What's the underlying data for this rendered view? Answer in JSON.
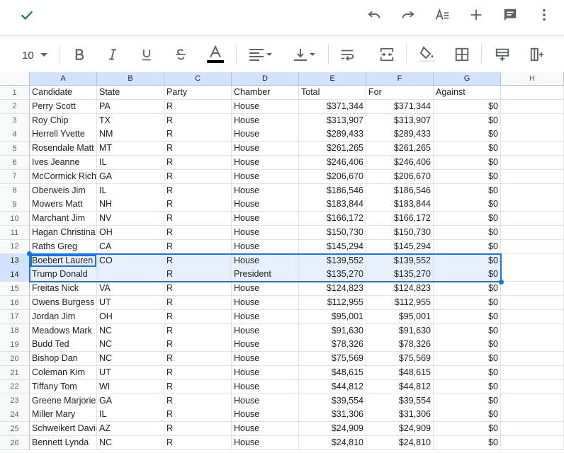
{
  "toolbar": {
    "font_size": "10"
  },
  "columns": [
    "A",
    "B",
    "C",
    "D",
    "E",
    "F",
    "G",
    "H"
  ],
  "rows": [
    {
      "n": "1",
      "c": [
        "Candidate",
        "State",
        "Party",
        "Chamber",
        "Total",
        "For",
        "Against"
      ]
    },
    {
      "n": "2",
      "c": [
        "Perry Scott",
        "PA",
        "R",
        "House",
        "$371,344",
        "$371,344",
        "$0"
      ]
    },
    {
      "n": "3",
      "c": [
        "Roy Chip",
        "TX",
        "R",
        "House",
        "$313,907",
        "$313,907",
        "$0"
      ]
    },
    {
      "n": "4",
      "c": [
        "Herrell Yvette",
        "NM",
        "R",
        "House",
        "$289,433",
        "$289,433",
        "$0"
      ]
    },
    {
      "n": "5",
      "c": [
        "Rosendale Matt",
        "MT",
        "R",
        "House",
        "$261,265",
        "$261,265",
        "$0"
      ]
    },
    {
      "n": "6",
      "c": [
        "Ives Jeanne",
        "IL",
        "R",
        "House",
        "$246,406",
        "$246,406",
        "$0"
      ]
    },
    {
      "n": "7",
      "c": [
        "McCormick Rich",
        "GA",
        "R",
        "House",
        "$206,670",
        "$206,670",
        "$0"
      ]
    },
    {
      "n": "8",
      "c": [
        "Oberweis Jim",
        "IL",
        "R",
        "House",
        "$186,546",
        "$186,546",
        "$0"
      ]
    },
    {
      "n": "9",
      "c": [
        "Mowers Matt",
        "NH",
        "R",
        "House",
        "$183,844",
        "$183,844",
        "$0"
      ]
    },
    {
      "n": "10",
      "c": [
        "Marchant Jim",
        "NV",
        "R",
        "House",
        "$166,172",
        "$166,172",
        "$0"
      ]
    },
    {
      "n": "11",
      "c": [
        "Hagan Christina",
        "OH",
        "R",
        "House",
        "$150,730",
        "$150,730",
        "$0"
      ]
    },
    {
      "n": "12",
      "c": [
        "Raths Greg",
        "CA",
        "R",
        "House",
        "$145,294",
        "$145,294",
        "$0"
      ]
    },
    {
      "n": "13",
      "c": [
        "Boebert Lauren",
        "CO",
        "R",
        "House",
        "$139,552",
        "$139,552",
        "$0"
      ]
    },
    {
      "n": "14",
      "c": [
        "Trump Donald",
        "",
        "R",
        "President",
        "$135,270",
        "$135,270",
        "$0"
      ]
    },
    {
      "n": "15",
      "c": [
        "Freitas Nick",
        "VA",
        "R",
        "House",
        "$124,823",
        "$124,823",
        "$0"
      ]
    },
    {
      "n": "16",
      "c": [
        "Owens Burgess",
        "UT",
        "R",
        "House",
        "$112,955",
        "$112,955",
        "$0"
      ]
    },
    {
      "n": "17",
      "c": [
        "Jordan Jim",
        "OH",
        "R",
        "House",
        "$95,001",
        "$95,001",
        "$0"
      ]
    },
    {
      "n": "18",
      "c": [
        "Meadows Mark",
        "NC",
        "R",
        "House",
        "$91,630",
        "$91,630",
        "$0"
      ]
    },
    {
      "n": "19",
      "c": [
        "Budd Ted",
        "NC",
        "R",
        "House",
        "$78,326",
        "$78,326",
        "$0"
      ]
    },
    {
      "n": "20",
      "c": [
        "Bishop Dan",
        "NC",
        "R",
        "House",
        "$75,569",
        "$75,569",
        "$0"
      ]
    },
    {
      "n": "21",
      "c": [
        "Coleman Kim",
        "UT",
        "R",
        "House",
        "$48,615",
        "$48,615",
        "$0"
      ]
    },
    {
      "n": "22",
      "c": [
        "Tiffany Tom",
        "WI",
        "R",
        "House",
        "$44,812",
        "$44,812",
        "$0"
      ]
    },
    {
      "n": "23",
      "c": [
        "Greene Marjorie",
        "GA",
        "R",
        "House",
        "$39,554",
        "$39,554",
        "$0"
      ]
    },
    {
      "n": "24",
      "c": [
        "Miller Mary",
        "IL",
        "R",
        "House",
        "$31,306",
        "$31,306",
        "$0"
      ]
    },
    {
      "n": "25",
      "c": [
        "Schweikert David",
        "AZ",
        "R",
        "House",
        "$24,909",
        "$24,909",
        "$0"
      ]
    },
    {
      "n": "26",
      "c": [
        "Bennett Lynda",
        "NC",
        "R",
        "House",
        "$24,810",
        "$24,810",
        "$0"
      ]
    }
  ],
  "selection": {
    "rows": [
      "13",
      "14"
    ],
    "columns": [
      "A",
      "B",
      "C",
      "D",
      "E",
      "F",
      "G"
    ]
  },
  "colors": {
    "accent": "#1a73e8",
    "check": "#188038",
    "selection_fill": "#e8f0fe"
  }
}
